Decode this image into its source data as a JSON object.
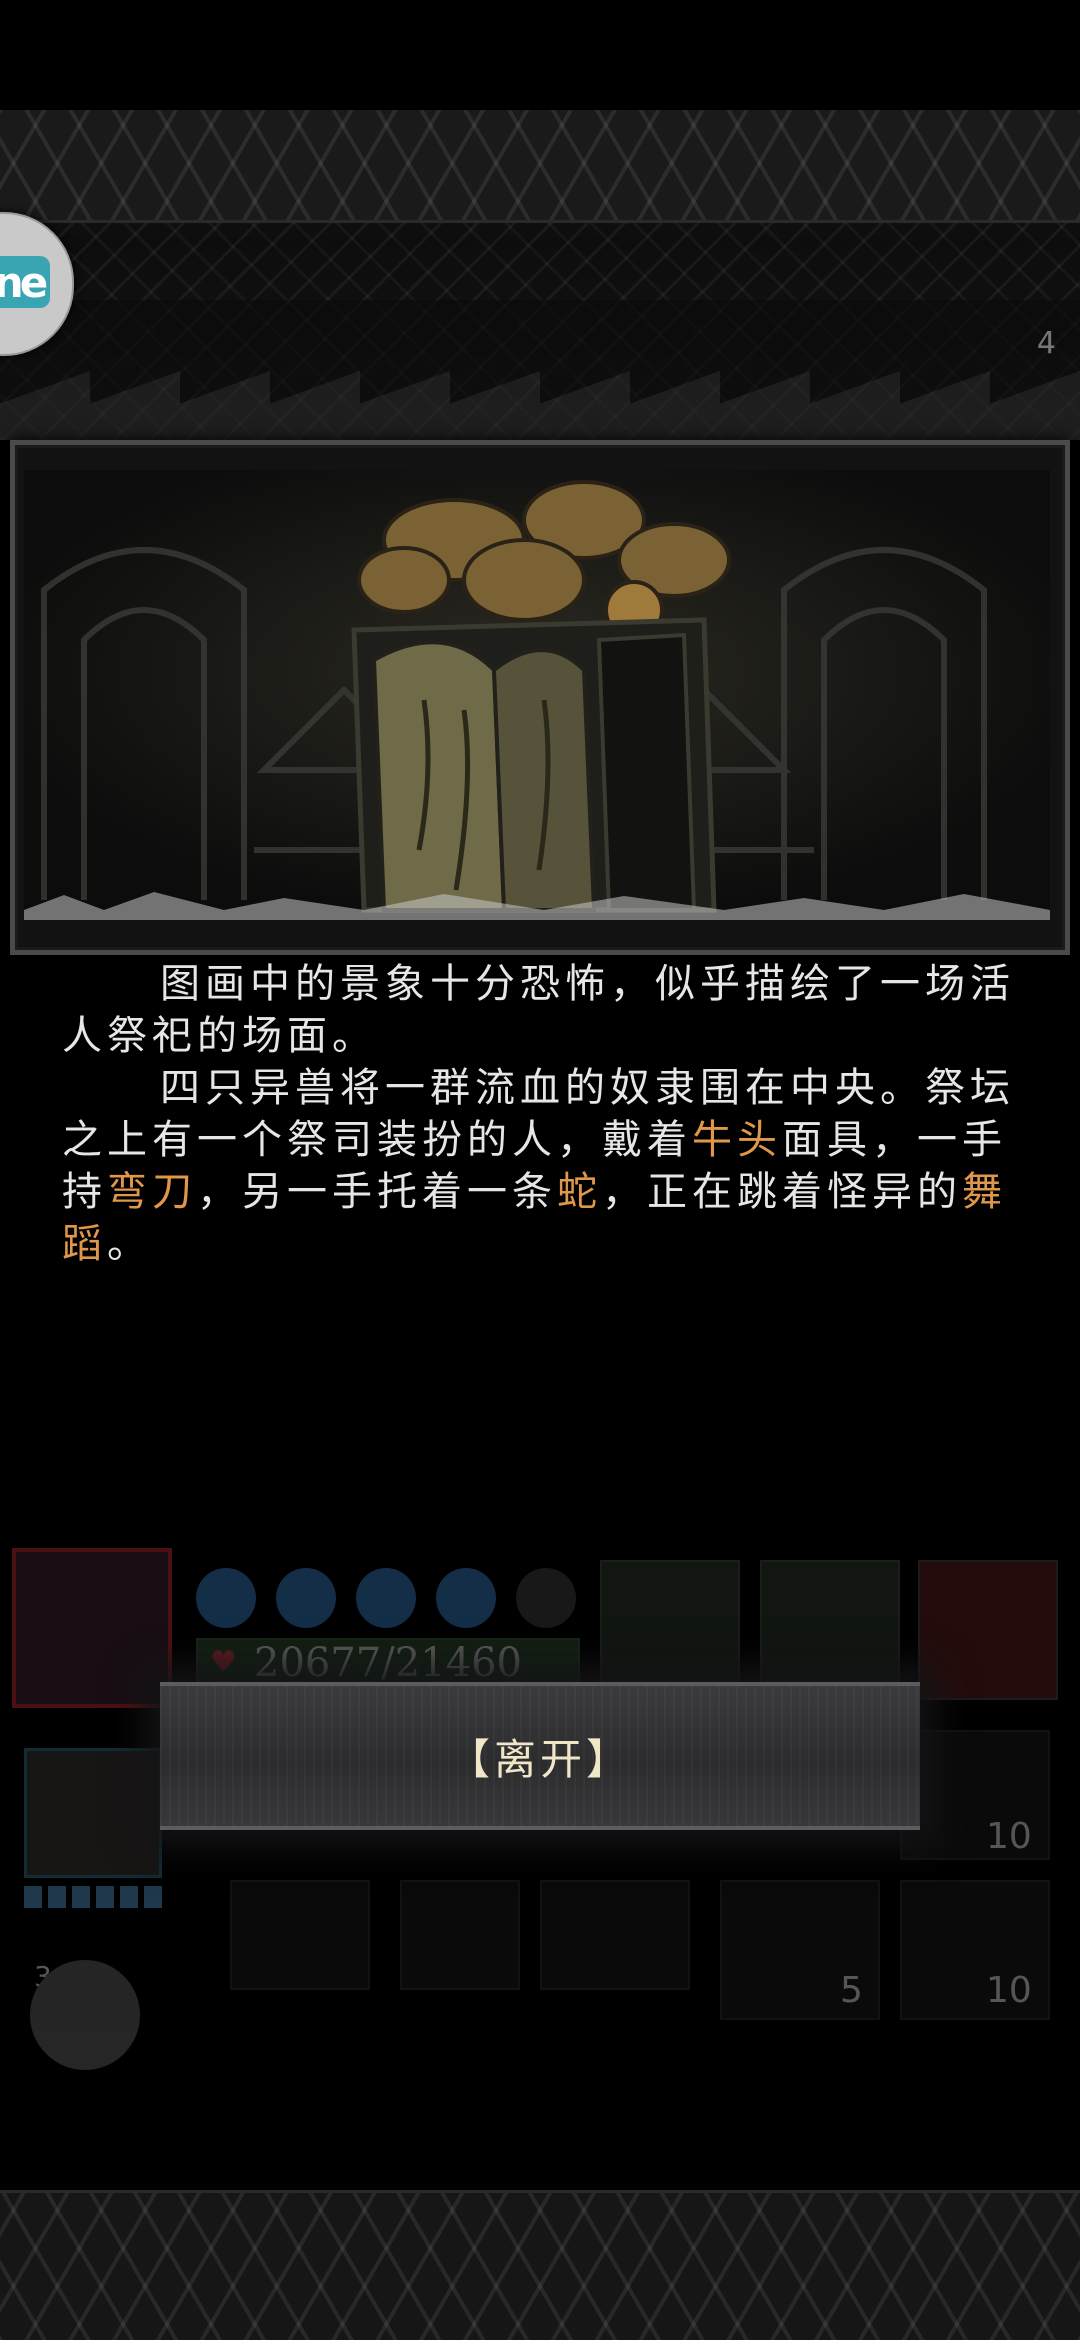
{
  "corner_button": {
    "badge": "ne"
  },
  "corner_counter": "4",
  "narrative": {
    "paragraph1": "图画中的景象十分恐怖，似乎描绘了一场活人祭祀的场面。",
    "p2_a": "四只异兽将一群流血的奴隶围在中央。祭坛之上有一个祭司装扮的人，戴着",
    "p2_hl1": "牛头",
    "p2_b": "面具，一手持",
    "p2_hl2": "弯刀",
    "p2_c": "，另一手托着一条",
    "p2_hl3": "蛇",
    "p2_d": "，正在跳着怪异的",
    "p2_hl4": "舞蹈",
    "p2_e": "。",
    "highlight_color": "#e0974a"
  },
  "party": {
    "hero1_index": "1",
    "hero1_hp": "20677/21460",
    "hero2_index": "2",
    "hero3_index": "3"
  },
  "inventory": {
    "count_a": "10",
    "count_b": "5",
    "count_c": "10"
  },
  "leave_button": {
    "label": "【离开】"
  }
}
